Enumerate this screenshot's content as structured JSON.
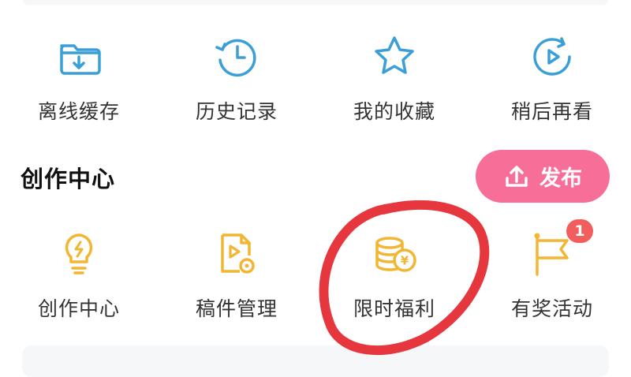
{
  "top_menu": [
    {
      "label": "离线缓存",
      "icon": "download-folder-icon"
    },
    {
      "label": "历史记录",
      "icon": "history-clock-icon"
    },
    {
      "label": "我的收藏",
      "icon": "star-icon"
    },
    {
      "label": "稍后再看",
      "icon": "watch-later-icon"
    }
  ],
  "creator": {
    "title": "创作中心",
    "publish_label": "发布",
    "items": [
      {
        "label": "创作中心",
        "icon": "lightbulb-icon"
      },
      {
        "label": "稿件管理",
        "icon": "manuscript-icon"
      },
      {
        "label": "限时福利",
        "icon": "coins-icon"
      },
      {
        "label": "有奖活动",
        "icon": "flag-icon"
      }
    ],
    "activity_badge": "1"
  },
  "colors": {
    "blue_icon": "#3a9fd6",
    "yellow_icon": "#f2b633",
    "publish_bg": "#f76f98",
    "badge": "#f25d5d",
    "annotation": "#e5262e"
  }
}
